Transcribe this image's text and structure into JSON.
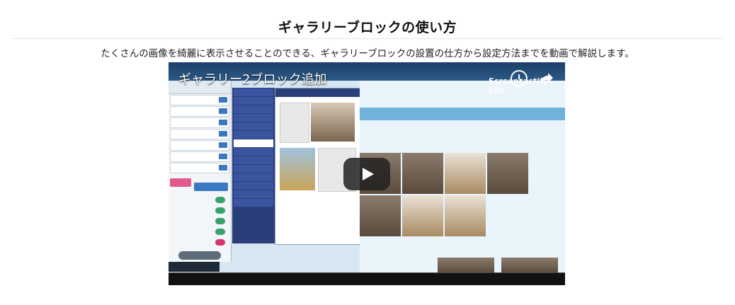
{
  "section": {
    "title": "ギャラリーブロックの使い方",
    "description": "たくさんの画像を綺麗に表示させることのできる、ギャラリーブロックの設置の仕方から設定方法までを動画で解説します。"
  },
  "video": {
    "title": "ギャラリー2ブロック追加",
    "logo_text": "Screencastify Lite",
    "icons": {
      "watch_later": "clock-icon",
      "share": "share-icon",
      "play": "play-icon"
    }
  },
  "colors": {
    "nav_blue": "#2a3f7a",
    "accent_blue": "#3a78c2",
    "site_bg": "#eaf4fb"
  }
}
